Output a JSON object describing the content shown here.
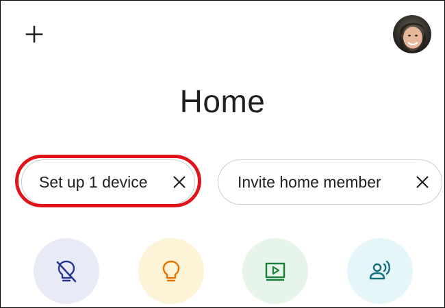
{
  "header": {
    "add_icon": "plus-icon",
    "avatar_icon": "user-avatar"
  },
  "page": {
    "title": "Home"
  },
  "chips": [
    {
      "label": "Set up 1 device",
      "close_icon": "close-icon",
      "highlighted": true,
      "highlight_color": "#e2141b"
    },
    {
      "label": "Invite home member",
      "close_icon": "close-icon",
      "highlighted": false
    }
  ],
  "shortcuts": [
    {
      "icon": "light-off-icon",
      "bg_color": "#e8eaf6",
      "icon_color": "#283593"
    },
    {
      "icon": "lightbulb-icon",
      "bg_color": "#fdf3d6",
      "icon_color": "#e37400"
    },
    {
      "icon": "media-play-icon",
      "bg_color": "#e6f4ea",
      "icon_color": "#188038"
    },
    {
      "icon": "speaking-person-icon",
      "bg_color": "#e4f6f8",
      "icon_color": "#12707a"
    }
  ]
}
